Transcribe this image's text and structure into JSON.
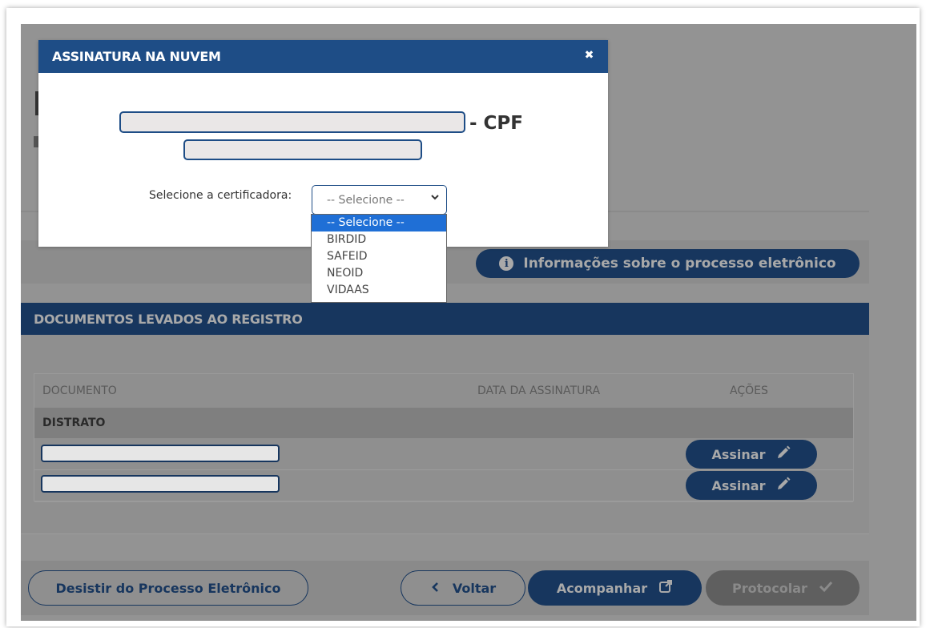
{
  "modal": {
    "title": "ASSINATURA NA NUVEM",
    "close_icon": "close-icon",
    "cpf_label": "- CPF",
    "certificadora_label": "Selecione a certificadora:",
    "select_value": "-- Selecione --",
    "options": [
      "-- Selecione --",
      "BIRDID",
      "SAFEID",
      "NEOID",
      "VIDAAS"
    ]
  },
  "info_button": {
    "label": "Informações sobre o processo eletrônico",
    "icon": "info-icon"
  },
  "documents": {
    "section_title": "DOCUMENTOS LEVADOS AO REGISTRO",
    "columns": [
      "DOCUMENTO",
      "DATA DA ASSINATURA",
      "AÇÕES"
    ],
    "group": "DISTRATO",
    "rows": [
      {
        "sign_label": "Assinar"
      },
      {
        "sign_label": "Assinar"
      }
    ]
  },
  "footer": {
    "desistir": "Desistir do Processo Eletrônico",
    "voltar": "Voltar",
    "acompanhar": "Acompanhar",
    "protocolar": "Protocolar"
  },
  "colors": {
    "brand": "#17365e",
    "modal_header": "#1e4d86",
    "overlay": "#939393",
    "option_highlight": "#1f6fd6"
  }
}
